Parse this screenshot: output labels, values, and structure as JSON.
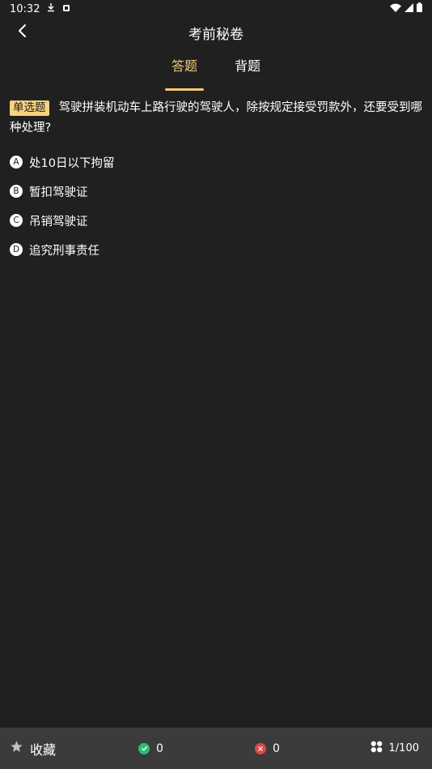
{
  "status_bar": {
    "time": "10:32"
  },
  "header": {
    "title": "考前秘卷"
  },
  "tabs": [
    {
      "label": "答题",
      "active": true
    },
    {
      "label": "背题",
      "active": false
    }
  ],
  "question": {
    "type_badge": "单选题",
    "text": "驾驶拼装机动车上路行驶的驾驶人，除按规定接受罚款外，还要受到哪种处理?"
  },
  "options": [
    {
      "letter": "A",
      "text": "处10日以下拘留"
    },
    {
      "letter": "B",
      "text": "暂扣驾驶证"
    },
    {
      "letter": "C",
      "text": "吊销驾驶证"
    },
    {
      "letter": "D",
      "text": "追究刑事责任"
    }
  ],
  "bottom_bar": {
    "favorite_label": "收藏",
    "correct_count": "0",
    "wrong_count": "0",
    "progress": "1/100"
  },
  "colors": {
    "background": "#202020",
    "accent": "#f2c878",
    "badge": "#f7d27f",
    "correct": "#2bbd6e",
    "wrong": "#e04848",
    "bottom_bar": "#3b3b3b"
  },
  "icons": {
    "back": "chevron-left-icon",
    "favorite": "star-icon",
    "correct": "check-circle-icon",
    "wrong": "x-circle-icon",
    "progress": "grid-icon",
    "status": [
      "download-icon",
      "recording-icon",
      "wifi-icon",
      "signal-icon",
      "battery-icon"
    ]
  }
}
